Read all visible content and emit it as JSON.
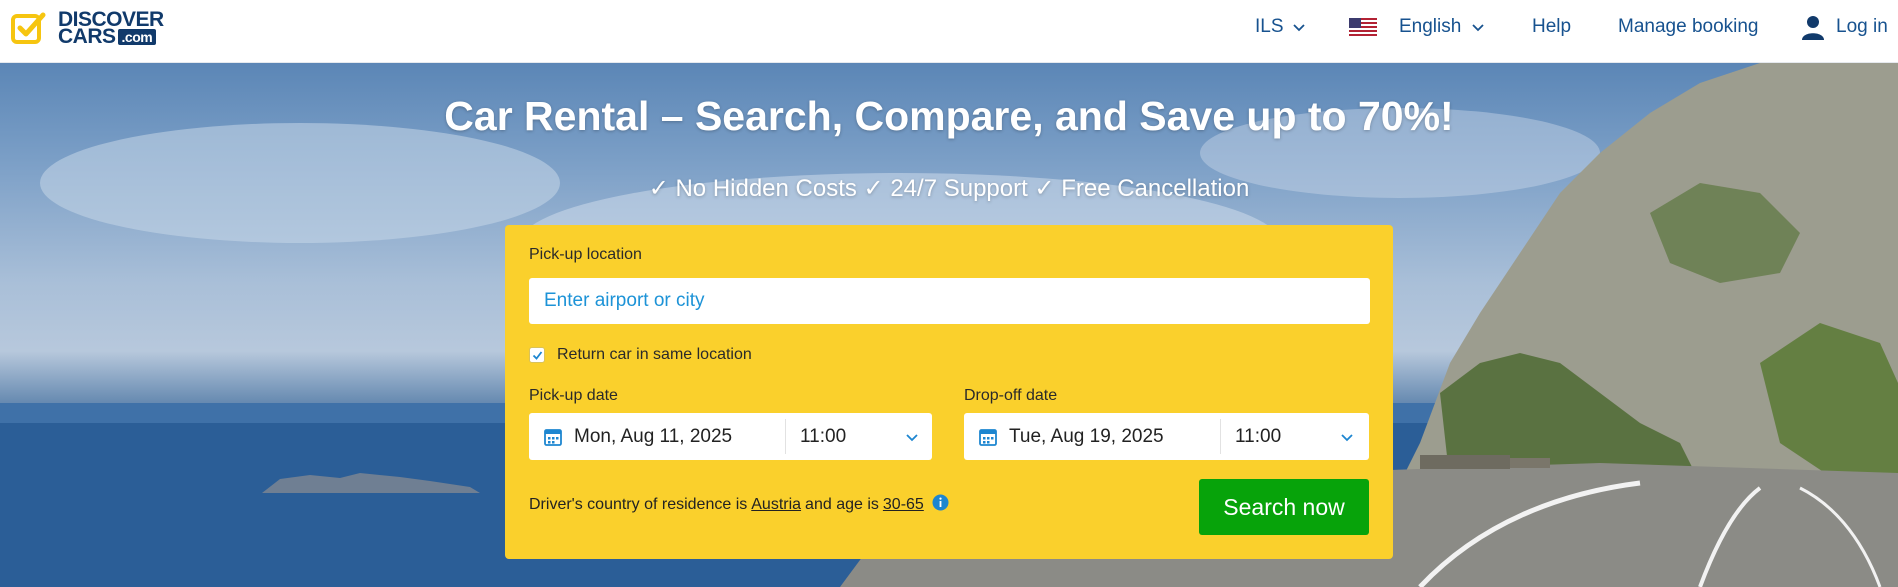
{
  "header": {
    "logo_line1": "DISCOVER",
    "logo_line2": "CARS",
    "logo_suffix": ".com",
    "currency": "ILS",
    "language": "English",
    "help": "Help",
    "manage_booking": "Manage booking",
    "login": "Log in",
    "link_color": "#17528f"
  },
  "hero": {
    "title": "Car Rental – Search, Compare, and Save up to 70%!",
    "subtitle": "✓ No Hidden Costs ✓ 24/7 Support ✓ Free Cancellation"
  },
  "search": {
    "pickup_location_label": "Pick-up location",
    "pickup_location_placeholder": "Enter airport or city",
    "pickup_location_value": "",
    "return_same_location_label": "Return car in same location",
    "return_same_location_checked": true,
    "pickup_date_label": "Pick-up date",
    "pickup_date": "Mon, Aug 11, 2025",
    "pickup_time": "11:00",
    "dropoff_date_label": "Drop-off date",
    "dropoff_date": "Tue, Aug 19, 2025",
    "dropoff_time": "11:00",
    "residence_prefix": "Driver's country of residence is",
    "residence_country": "Austria",
    "age_prefix": "and age is",
    "age_range": "30-65",
    "search_button": "Search now",
    "card_color": "#fad02c",
    "button_color": "#07a30a"
  }
}
